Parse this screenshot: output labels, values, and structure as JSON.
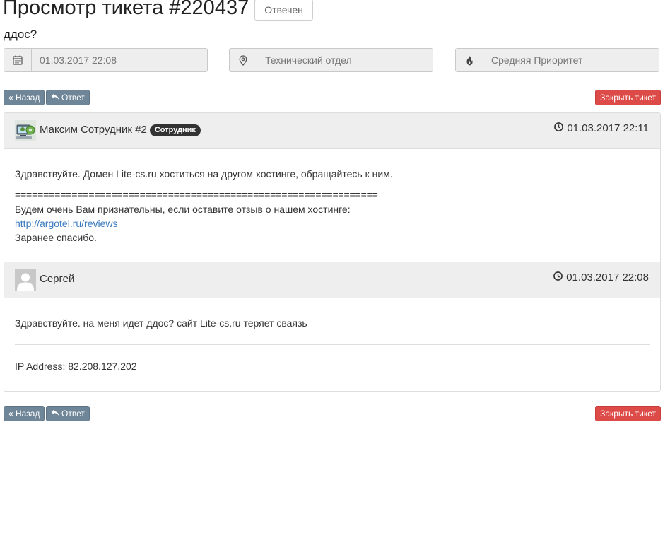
{
  "header": {
    "title": "Просмотр тикета #220437",
    "status": "Отвечен",
    "subject": "ддос?"
  },
  "info": {
    "date": "01.03.2017 22:08",
    "department": "Технический отдел",
    "priority": "Средняя Приоритет"
  },
  "actions": {
    "back_label": "« Назад",
    "reply_label": "Ответ",
    "close_label": "Закрыть тикет"
  },
  "messages": [
    {
      "author": "Максим Сотрудник #2",
      "role": "Сотрудник",
      "date": "01.03.2017 22:11",
      "lines": [
        "Здравствуйте. Домен Lite-cs.ru хоститься на другом хостинге, обращайтесь к ним.",
        "================================================================",
        "Будем очень Вам признательны, если оставите отзыв о нашем хостинге:",
        "http://argotel.ru/reviews",
        "Заранее спасибо."
      ]
    },
    {
      "author": "Сергей",
      "date": "01.03.2017 22:08",
      "text": "Здравствуйте. на меня идет ддос? сайт Lite-cs.ru теряет сваязь",
      "ip": "IP Address: 82.208.127.202"
    }
  ],
  "colors": {
    "grey_button": "#6f8699",
    "red_button": "#dd4b48",
    "link": "#3a7bbf",
    "panel_header": "#eeeeee"
  },
  "icons": {
    "date": "calendar-icon",
    "department": "map-marker-icon",
    "priority": "fire-icon",
    "reply": "reply-icon",
    "clock": "clock-icon",
    "staff_avatar": "staff-avatar-icon",
    "user_avatar": "user-avatar-icon"
  }
}
